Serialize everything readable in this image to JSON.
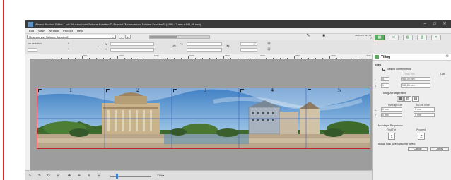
{
  "window": {
    "title": "Atomic Product Editor - Job \"Museum van Schone Kunsten2\", Product \"Museum van Schone Kunsten2\" (4880,42 mm x 941,88 mm)",
    "min_glyph": "–",
    "max_glyph": "□",
    "close_glyph": "✕"
  },
  "menu": [
    "Edit",
    "View",
    "Window",
    "Product",
    "Help"
  ],
  "toolbar": {
    "product_select": "Museum van Schone Kunsten2",
    "select_arrow": "▾",
    "prev_arrow": "◂",
    "next_arrow": "▸",
    "progress_fraction": 0.45,
    "size_line1": "4880,42 x 941,88 mm",
    "size_line2": "6 / 6 x"
  },
  "toolbar2": {
    "fit_label": "(no selection)",
    "x_label": "X",
    "y_label": "Y",
    "w_label": "W",
    "h_label": "H",
    "link_icon": "↔",
    "px_label": "PX",
    "rotate_icon": "⟲",
    "flip_icon": "⇋",
    "angle_value": "0°"
  },
  "right_tabs": [
    "▦",
    "▭",
    "▤",
    "▥",
    "✦"
  ],
  "ruler": {
    "labels": [
      "500",
      "1000",
      "1500",
      "2000",
      "2500",
      "3000",
      "3500",
      "4000",
      "4500"
    ]
  },
  "canvas": {
    "tile_numbers": [
      "1",
      "2",
      "3",
      "4",
      "5"
    ]
  },
  "panel": {
    "title": "Tiling",
    "gear": "⚙",
    "tiles_heading": "Tiles",
    "tiles_for_media_label": "Tiles for current media",
    "tiles_for_media_checked": "✓",
    "max_tiles_label": "Max tiles",
    "last_label": "Last",
    "width_icon": "↔",
    "height_icon": "↕",
    "cols_value": "5",
    "rows_value": "1",
    "width_value": "980,00 mm",
    "height_value": "941,88 mm",
    "arrangement_heading": "Tiling Arrangement",
    "overlap_label": "Overlap Size",
    "noink_label": "No-ink zone",
    "overlap_h": "0 mm",
    "overlap_v": "0 mm",
    "noink_h": "0 mm",
    "noink_v": "0 mm",
    "montage_heading": "Montage Sequence",
    "first_tile_label": "First Tile",
    "proceed_label": "Proceed",
    "first_tile_value": "1",
    "proceed_value": "Z",
    "actual_size_label": "Actual Total Size (including bleed)",
    "cancel_label": "Cancel",
    "apply_label": "Apply"
  },
  "status": {
    "zoom": "33%",
    "zoom_arrow": "▾"
  }
}
